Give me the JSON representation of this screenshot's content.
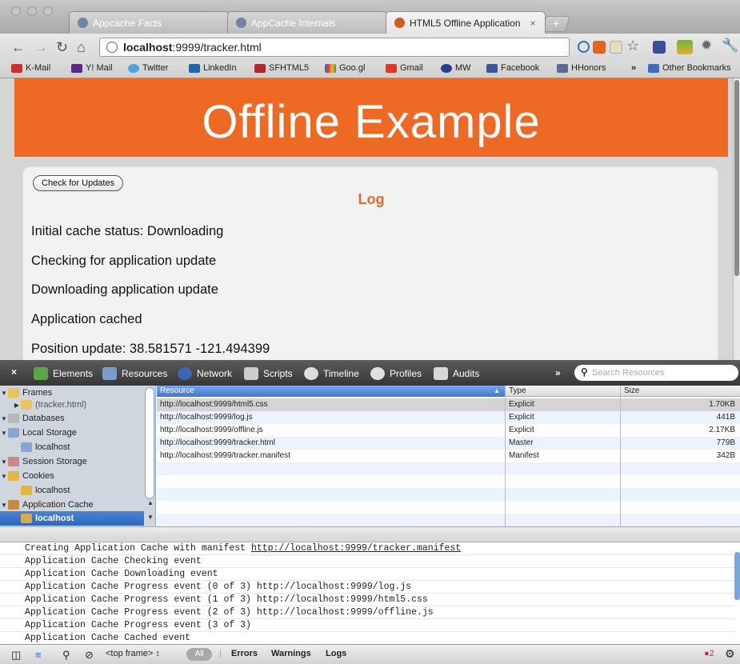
{
  "browser": {
    "tabs": [
      {
        "title": "Appcache Facts"
      },
      {
        "title": "AppCache Internals"
      },
      {
        "title": "HTML5 Offline Application",
        "close": "×"
      }
    ],
    "new_tab_glyph": "+",
    "url": {
      "host": "localhost",
      "rest": ":9999/tracker.html"
    },
    "bookmarks": [
      "K-Mail",
      "Y! Mail",
      "Twitter",
      "LinkedIn",
      "SFHTML5",
      "Goo.gl",
      "Gmail",
      "MW",
      "Facebook",
      "HHonors"
    ],
    "overflow": "»",
    "other_bookmarks": "Other Bookmarks"
  },
  "page": {
    "banner": "Offline Example",
    "check_button": "Check for Updates",
    "log_heading": "Log",
    "log_lines": [
      "Initial cache status: Downloading",
      "Checking for application update",
      "Downloading application update",
      "Application cached",
      "Position update: 38.581571 -121.494399"
    ]
  },
  "devtools": {
    "close": "×",
    "tabs": [
      "Elements",
      "Resources",
      "Network",
      "Scripts",
      "Timeline",
      "Profiles",
      "Audits"
    ],
    "more": "»",
    "search_placeholder": "Search Resources",
    "sidebar": [
      {
        "label": "Frames",
        "level": 0,
        "open": true
      },
      {
        "label": "(tracker.html)",
        "level": 1,
        "open": false
      },
      {
        "label": "Databases",
        "level": 0,
        "open": true
      },
      {
        "label": "Local Storage",
        "level": 0,
        "open": true
      },
      {
        "label": "localhost",
        "level": 1
      },
      {
        "label": "Session Storage",
        "level": 0,
        "open": true
      },
      {
        "label": "Cookies",
        "level": 0,
        "open": true
      },
      {
        "label": "localhost",
        "level": 1
      },
      {
        "label": "Application Cache",
        "level": 0,
        "open": true
      },
      {
        "label": "localhost",
        "level": 1,
        "selected": true
      }
    ],
    "resource_columns": [
      "Resource",
      "Type",
      "Size"
    ],
    "resources": [
      {
        "url": "http://localhost:9999/html5.css",
        "type": "Explicit",
        "size": "1.70KB"
      },
      {
        "url": "http://localhost:9999/log.js",
        "type": "Explicit",
        "size": "441B"
      },
      {
        "url": "http://localhost:9999/offline.js",
        "type": "Explicit",
        "size": "2.17KB"
      },
      {
        "url": "http://localhost:9999/tracker.html",
        "type": "Master",
        "size": "779B"
      },
      {
        "url": "http://localhost:9999/tracker.manifest",
        "type": "Manifest",
        "size": "342B"
      }
    ],
    "console_first": {
      "text": "Creating Application Cache with manifest ",
      "link": "http://localhost:9999/tracker.manifest"
    },
    "console": [
      "Application Cache Checking event",
      "Application Cache Downloading event",
      "Application Cache Progress event (0 of 3) http://localhost:9999/log.js",
      "Application Cache Progress event (1 of 3) http://localhost:9999/html5.css",
      "Application Cache Progress event (2 of 3) http://localhost:9999/offline.js",
      "Application Cache Progress event (3 of 3)",
      "Application Cache Cached event"
    ],
    "status": {
      "frame": "<top frame>",
      "all": "All",
      "filters": [
        "Errors",
        "Warnings",
        "Logs"
      ],
      "error_count": "2"
    }
  }
}
